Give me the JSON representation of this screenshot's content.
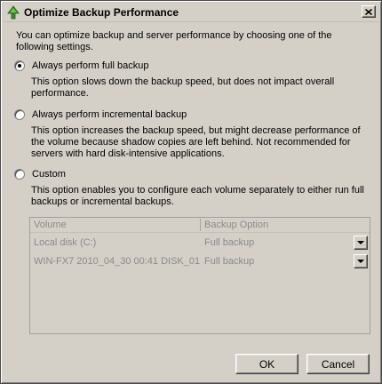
{
  "window": {
    "title": "Optimize Backup Performance",
    "app_icon": "backup-tree-icon",
    "close_icon": "close-icon"
  },
  "intro_text": "You can optimize backup and server performance by choosing one of the following settings.",
  "options": [
    {
      "label": "Always perform full backup",
      "selected": true,
      "description": "This option slows down the backup speed, but does not impact overall performance."
    },
    {
      "label": "Always perform incremental backup",
      "selected": false,
      "description": "This option increases the backup speed, but might decrease performance of the volume because shadow copies are left behind. Not recommended for servers with hard disk-intensive applications."
    },
    {
      "label": "Custom",
      "selected": false,
      "description": "This option enables you to configure each volume separately to either run full backups or incremental backups."
    }
  ],
  "volume_table": {
    "columns": [
      "Volume",
      "Backup Option"
    ],
    "rows": [
      {
        "volume": "Local disk (C:)",
        "option": "Full backup"
      },
      {
        "volume": "WIN-FX7 2010_04_30 00:41 DISK_01",
        "option": "Full backup"
      }
    ]
  },
  "buttons": {
    "ok": "OK",
    "cancel": "Cancel"
  },
  "colors": {
    "dialog_bg": "#d4d0c8",
    "disabled_text": "#8a8a8a"
  }
}
